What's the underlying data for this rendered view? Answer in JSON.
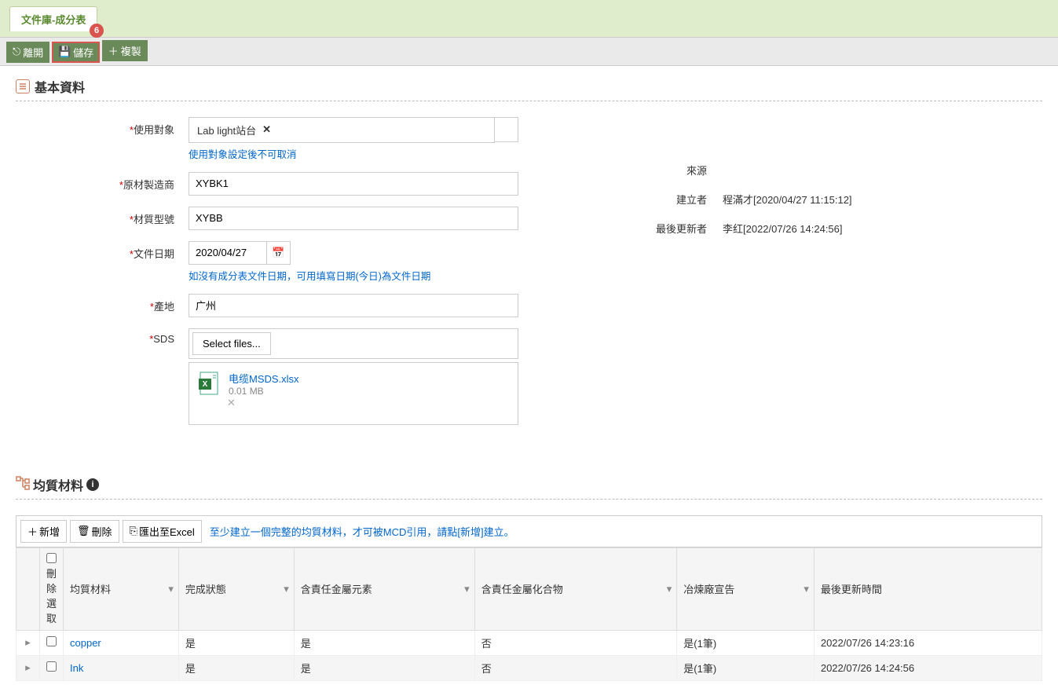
{
  "tab": {
    "title": "文件庫-成分表",
    "badge": "6"
  },
  "toolbar": {
    "leave": "離開",
    "save": "儲存",
    "copy": "複製"
  },
  "section_basic": {
    "title": "基本資料"
  },
  "form": {
    "target_label": "使用對象",
    "target_value": "Lab light站台",
    "target_hint": "使用對象設定後不可取消",
    "mfr_label": "原材製造商",
    "mfr_value": "XYBK1",
    "model_label": "材質型號",
    "model_value": "XYBB",
    "doc_date_label": "文件日期",
    "doc_date_value": "2020/04/27",
    "doc_date_hint": "如沒有成分表文件日期，可用填寫日期(今日)為文件日期",
    "origin_label": "產地",
    "origin_value": "广州",
    "sds_label": "SDS",
    "sds_select": "Select files...",
    "sds_file_name": "电缆MSDS.xlsx",
    "sds_file_size": "0.01 MB"
  },
  "info": {
    "source_label": "來源",
    "source_value": "",
    "creator_label": "建立者",
    "creator_value": "程滿才[2020/04/27 11:15:12]",
    "updater_label": "最後更新者",
    "updater_value": "李红[2022/07/26 14:24:56]"
  },
  "section_hom": {
    "title": "均質材料"
  },
  "grid_toolbar": {
    "add": "新增",
    "del": "刪除",
    "export": "匯出至Excel",
    "hint": "至少建立一個完整的均質材料，才可被MCD引用，請點[新增]建立。"
  },
  "grid": {
    "headers": {
      "del_sel": "刪除選取",
      "material": "均質材料",
      "status": "完成狀態",
      "metal": "含責任金屬元素",
      "compound": "含責任金屬化合物",
      "smelter": "冶煉廠宣告",
      "updated": "最後更新時間"
    },
    "rows": [
      {
        "material": "copper",
        "status": "是",
        "metal": "是",
        "compound": "否",
        "smelter": "是(1筆)",
        "updated": "2022/07/26 14:23:16"
      },
      {
        "material": "Ink",
        "status": "是",
        "metal": "是",
        "compound": "否",
        "smelter": "是(1筆)",
        "updated": "2022/07/26 14:24:56"
      }
    ]
  }
}
